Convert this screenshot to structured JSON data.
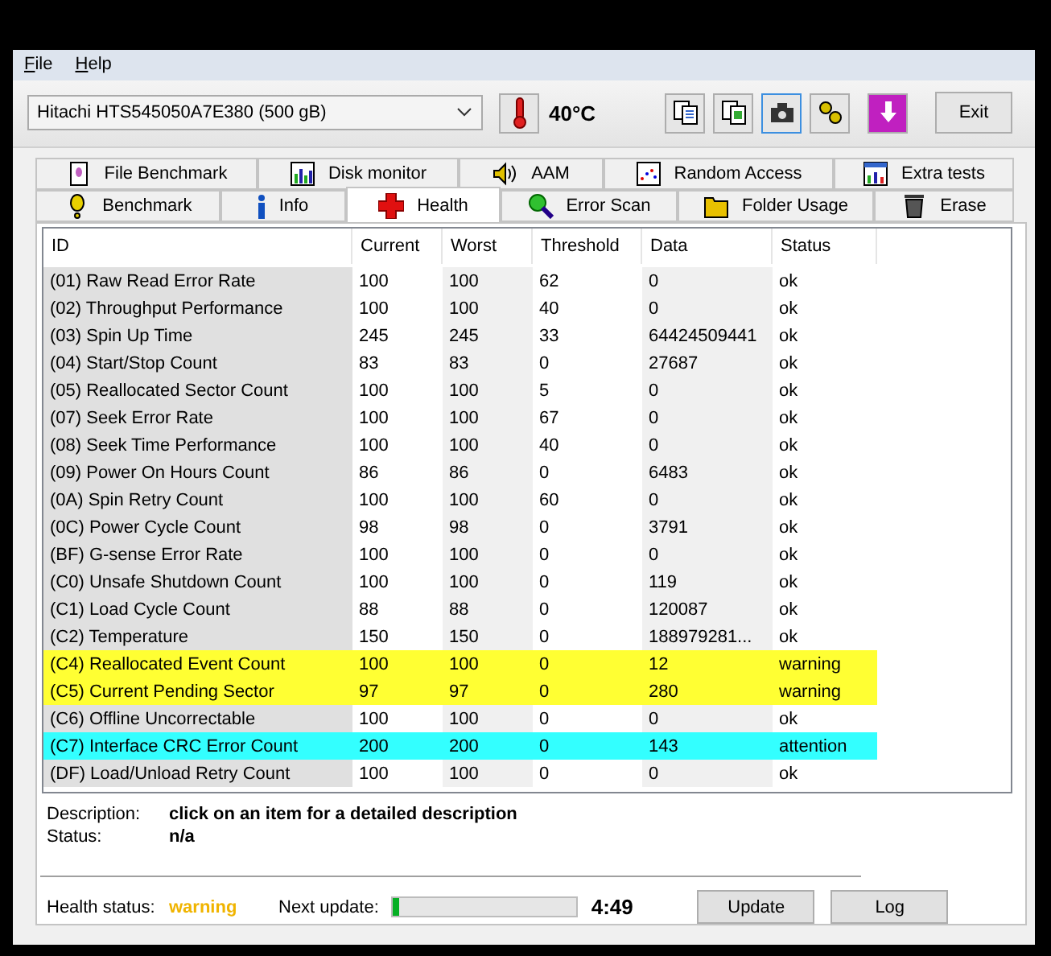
{
  "menu": [
    {
      "label": "File"
    },
    {
      "label": "Help"
    }
  ],
  "drive": {
    "value": "Hitachi HTS545050A7E380 (500 gB)"
  },
  "temperature": "40°C",
  "exit_button": "Exit",
  "tab_rows": [
    [
      {
        "label": "File Benchmark",
        "kind": "filebench",
        "selected": false
      },
      {
        "label": "Disk monitor",
        "kind": "monitor",
        "selected": false
      },
      {
        "label": "AAM",
        "kind": "aam",
        "selected": false
      },
      {
        "label": "Random Access",
        "kind": "random",
        "selected": false
      },
      {
        "label": "Extra tests",
        "kind": "extra",
        "selected": false
      }
    ],
    [
      {
        "label": "Benchmark",
        "kind": "bench",
        "selected": false
      },
      {
        "label": "Info",
        "kind": "info",
        "selected": false
      },
      {
        "label": "Health",
        "kind": "health",
        "selected": true
      },
      {
        "label": "Error Scan",
        "kind": "scan",
        "selected": false
      },
      {
        "label": "Folder Usage",
        "kind": "folder",
        "selected": false
      },
      {
        "label": "Erase",
        "kind": "erase",
        "selected": false
      }
    ]
  ],
  "table": {
    "columns": [
      "ID",
      "Current",
      "Worst",
      "Threshold",
      "Data",
      "Status"
    ],
    "rows": [
      {
        "kind": "normal",
        "cells": [
          "(01) Raw Read Error Rate",
          "100",
          "100",
          "62",
          "0",
          "ok"
        ]
      },
      {
        "kind": "normal",
        "cells": [
          "(02) Throughput Performance",
          "100",
          "100",
          "40",
          "0",
          "ok"
        ]
      },
      {
        "kind": "normal",
        "cells": [
          "(03) Spin Up Time",
          "245",
          "245",
          "33",
          "64424509441",
          "ok"
        ]
      },
      {
        "kind": "normal",
        "cells": [
          "(04) Start/Stop Count",
          "83",
          "83",
          "0",
          "27687",
          "ok"
        ]
      },
      {
        "kind": "normal",
        "cells": [
          "(05) Reallocated Sector Count",
          "100",
          "100",
          "5",
          "0",
          "ok"
        ]
      },
      {
        "kind": "normal",
        "cells": [
          "(07) Seek Error Rate",
          "100",
          "100",
          "67",
          "0",
          "ok"
        ]
      },
      {
        "kind": "normal",
        "cells": [
          "(08) Seek Time Performance",
          "100",
          "100",
          "40",
          "0",
          "ok"
        ]
      },
      {
        "kind": "normal",
        "cells": [
          "(09) Power On Hours Count",
          "86",
          "86",
          "0",
          "6483",
          "ok"
        ]
      },
      {
        "kind": "normal",
        "cells": [
          "(0A) Spin Retry Count",
          "100",
          "100",
          "60",
          "0",
          "ok"
        ]
      },
      {
        "kind": "normal",
        "cells": [
          "(0C) Power Cycle Count",
          "98",
          "98",
          "0",
          "3791",
          "ok"
        ]
      },
      {
        "kind": "normal",
        "cells": [
          "(BF) G-sense Error Rate",
          "100",
          "100",
          "0",
          "0",
          "ok"
        ]
      },
      {
        "kind": "normal",
        "cells": [
          "(C0) Unsafe Shutdown Count",
          "100",
          "100",
          "0",
          "119",
          "ok"
        ]
      },
      {
        "kind": "normal",
        "cells": [
          "(C1) Load Cycle Count",
          "88",
          "88",
          "0",
          "120087",
          "ok"
        ]
      },
      {
        "kind": "normal",
        "cells": [
          "(C2) Temperature",
          "150",
          "150",
          "0",
          "188979281...",
          "ok"
        ]
      },
      {
        "kind": "warning",
        "cells": [
          "(C4) Reallocated Event Count",
          "100",
          "100",
          "0",
          "12",
          "warning"
        ]
      },
      {
        "kind": "warning",
        "cells": [
          "(C5) Current Pending Sector",
          "97",
          "97",
          "0",
          "280",
          "warning"
        ]
      },
      {
        "kind": "normal",
        "cells": [
          "(C6) Offline Uncorrectable",
          "100",
          "100",
          "0",
          "0",
          "ok"
        ]
      },
      {
        "kind": "attention",
        "cells": [
          "(C7) Interface CRC Error Count",
          "200",
          "200",
          "0",
          "143",
          "attention"
        ]
      },
      {
        "kind": "normal",
        "cells": [
          "(DF) Load/Unload Retry Count",
          "100",
          "100",
          "0",
          "0",
          "ok"
        ]
      }
    ]
  },
  "description": {
    "label": "Description:",
    "value": "click on an item for a detailed description"
  },
  "status": {
    "label": "Status:",
    "value": "n/a"
  },
  "health_status": {
    "label": "Health status:",
    "value": "warning",
    "color": "#f0b400"
  },
  "next_update": {
    "label": "Next update:",
    "level": 0.03,
    "time": "4:49"
  },
  "buttons": [
    "Update",
    "Log"
  ]
}
